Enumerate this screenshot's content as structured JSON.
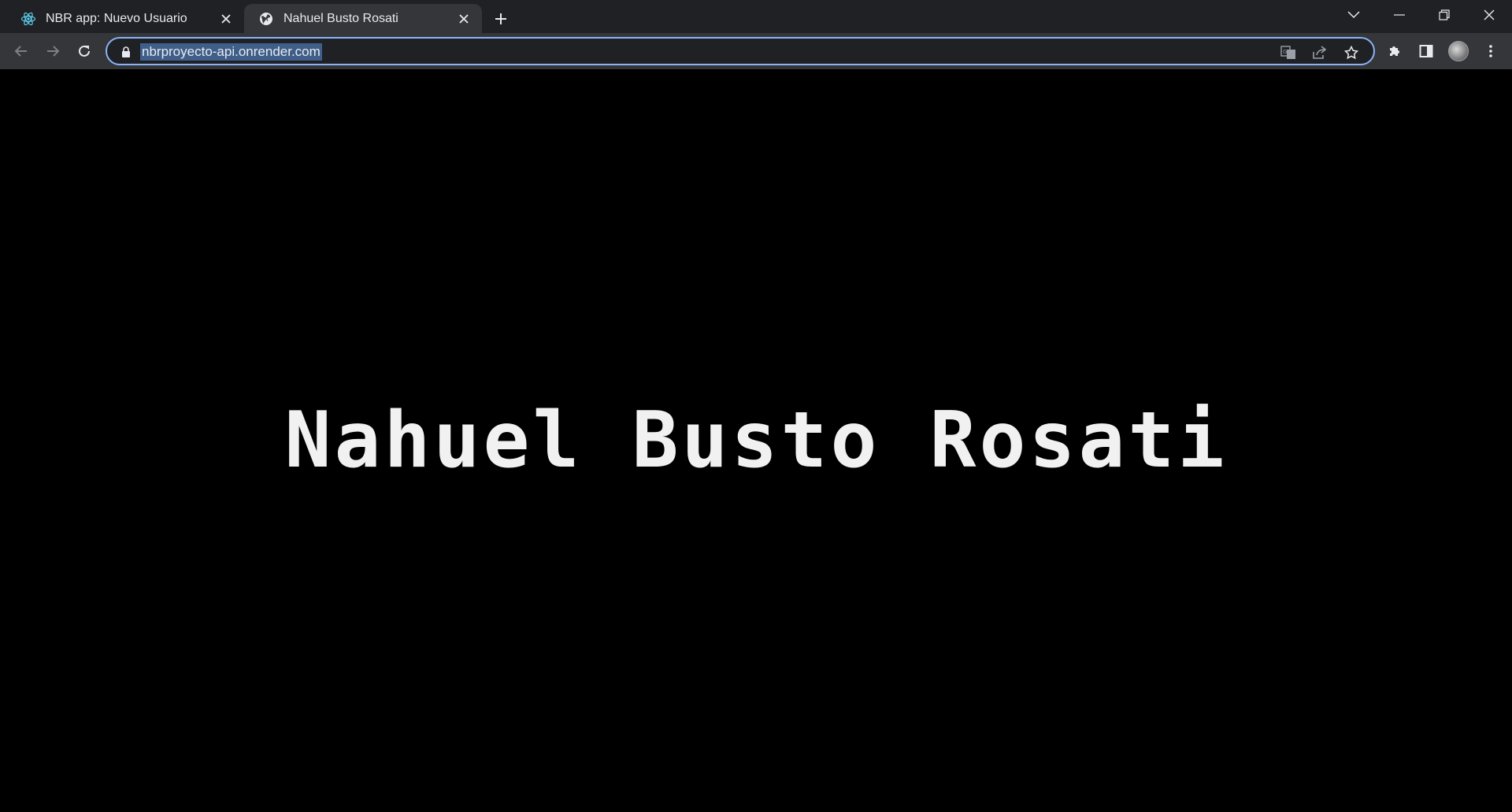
{
  "tabs": [
    {
      "title": "NBR app: Nuevo Usuario",
      "favicon": "react-atom-icon",
      "active": false
    },
    {
      "title": "Nahuel Busto Rosati",
      "favicon": "globe-icon",
      "active": true
    }
  ],
  "omnibox": {
    "url": "nbrproyecto-api.onrender.com",
    "secure": true
  },
  "page": {
    "heading": "Nahuel Busto Rosati"
  },
  "colors": {
    "tabstrip": "#202124",
    "toolbar": "#35363a",
    "focus_ring": "#8ab4f8",
    "page_bg": "#000000",
    "heading": "#f1f1f1"
  }
}
